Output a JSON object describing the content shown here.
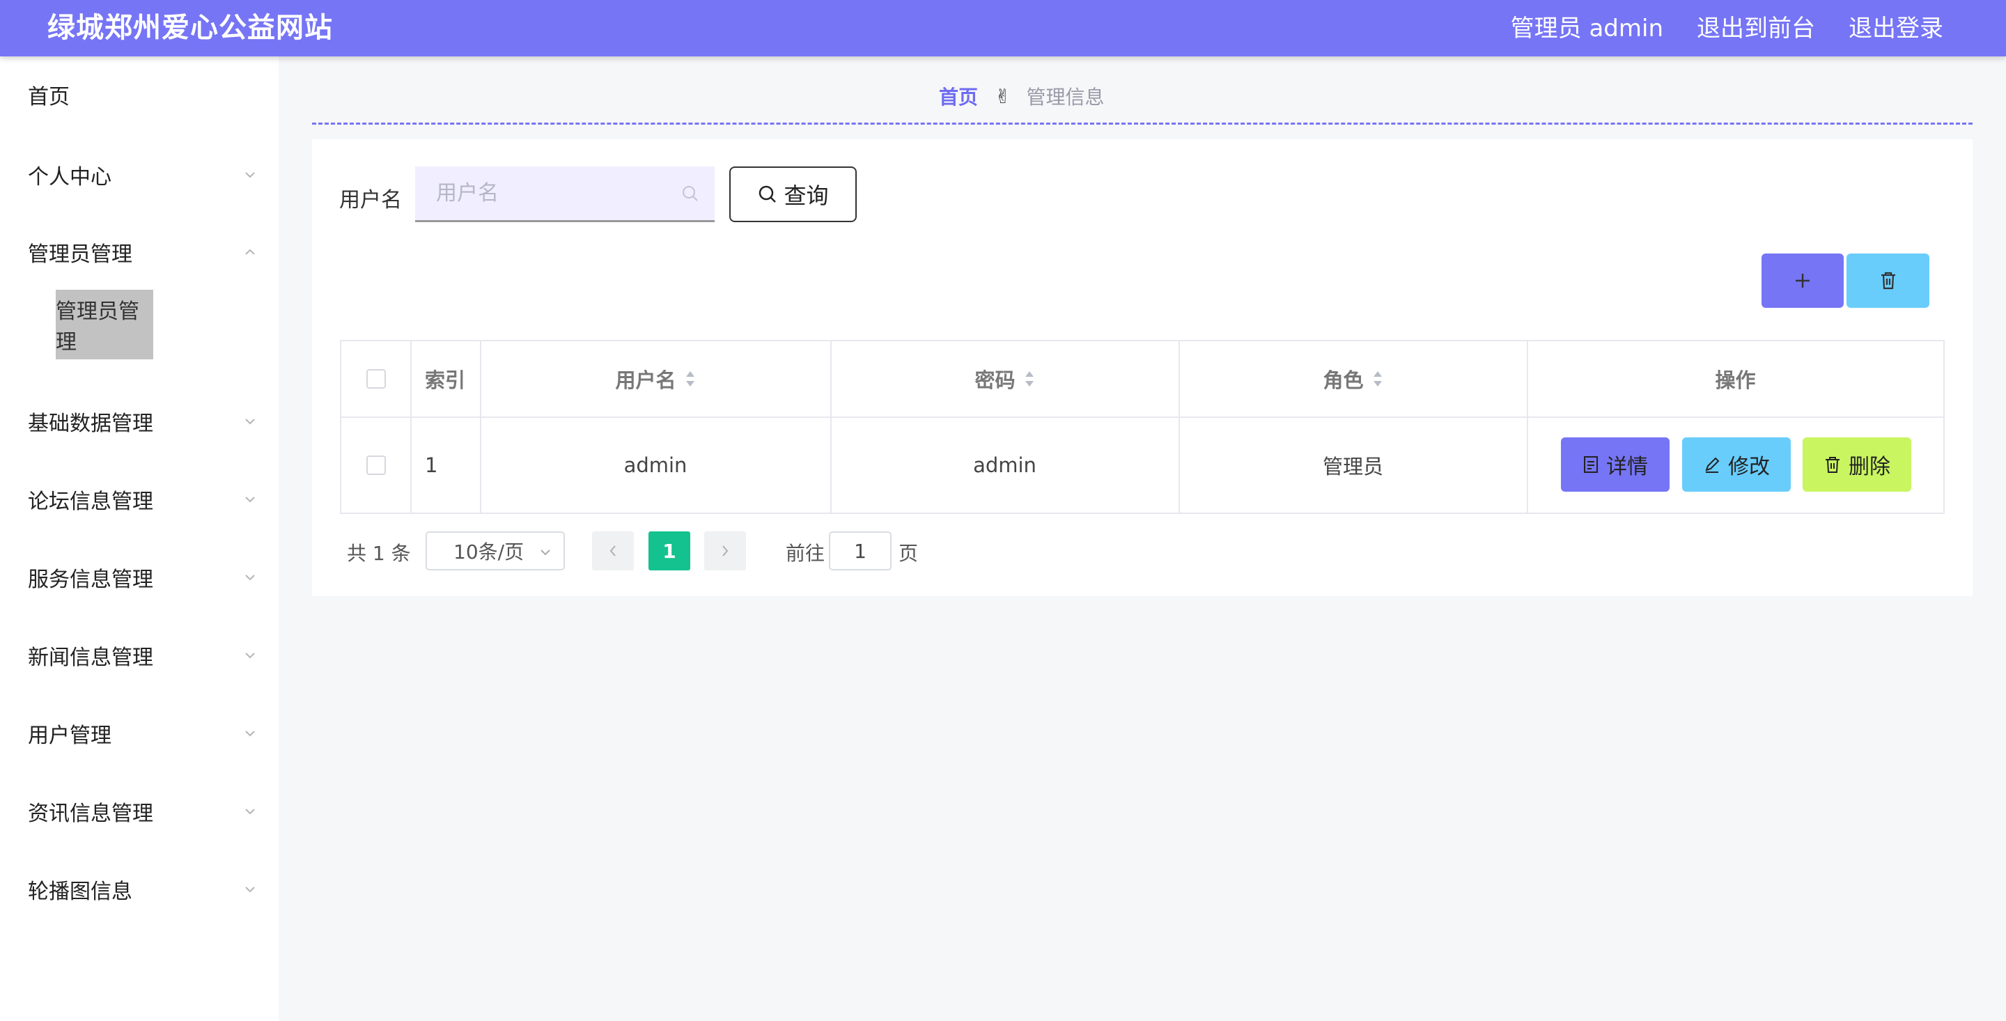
{
  "header": {
    "title": "绿城郑州爱心公益网站",
    "admin_label": "管理员 admin",
    "to_front": "退出到前台",
    "logout": "退出登录"
  },
  "sidebar": {
    "items": [
      {
        "label": "首页"
      },
      {
        "label": "个人中心"
      },
      {
        "label": "管理员管理"
      },
      {
        "label": "基础数据管理"
      },
      {
        "label": "论坛信息管理"
      },
      {
        "label": "服务信息管理"
      },
      {
        "label": "新闻信息管理"
      },
      {
        "label": "用户管理"
      },
      {
        "label": "资讯信息管理"
      },
      {
        "label": "轮播图信息"
      }
    ],
    "active_sub": "管理员管理"
  },
  "breadcrumb": {
    "home": "首页",
    "separator": "✌",
    "current": "管理信息"
  },
  "search": {
    "label": "用户名",
    "placeholder": "用户名",
    "value": "",
    "button": "查询"
  },
  "table": {
    "headers": {
      "index": "索引",
      "username": "用户名",
      "password": "密码",
      "role": "角色",
      "actions": "操作"
    },
    "rows": [
      {
        "index": "1",
        "username": "admin",
        "password": "admin",
        "role": "管理员"
      }
    ],
    "actions": {
      "detail": "详情",
      "edit": "修改",
      "delete": "删除"
    }
  },
  "pagination": {
    "total": "共 1 条",
    "page_size": "10条/页",
    "current_page": "1",
    "goto_prefix": "前往",
    "goto_value": "1",
    "goto_suffix": "页"
  },
  "colors": {
    "primary": "#7675f5",
    "info": "#69cdfc",
    "danger_btn": "#c9f560",
    "success": "#13c28e"
  }
}
